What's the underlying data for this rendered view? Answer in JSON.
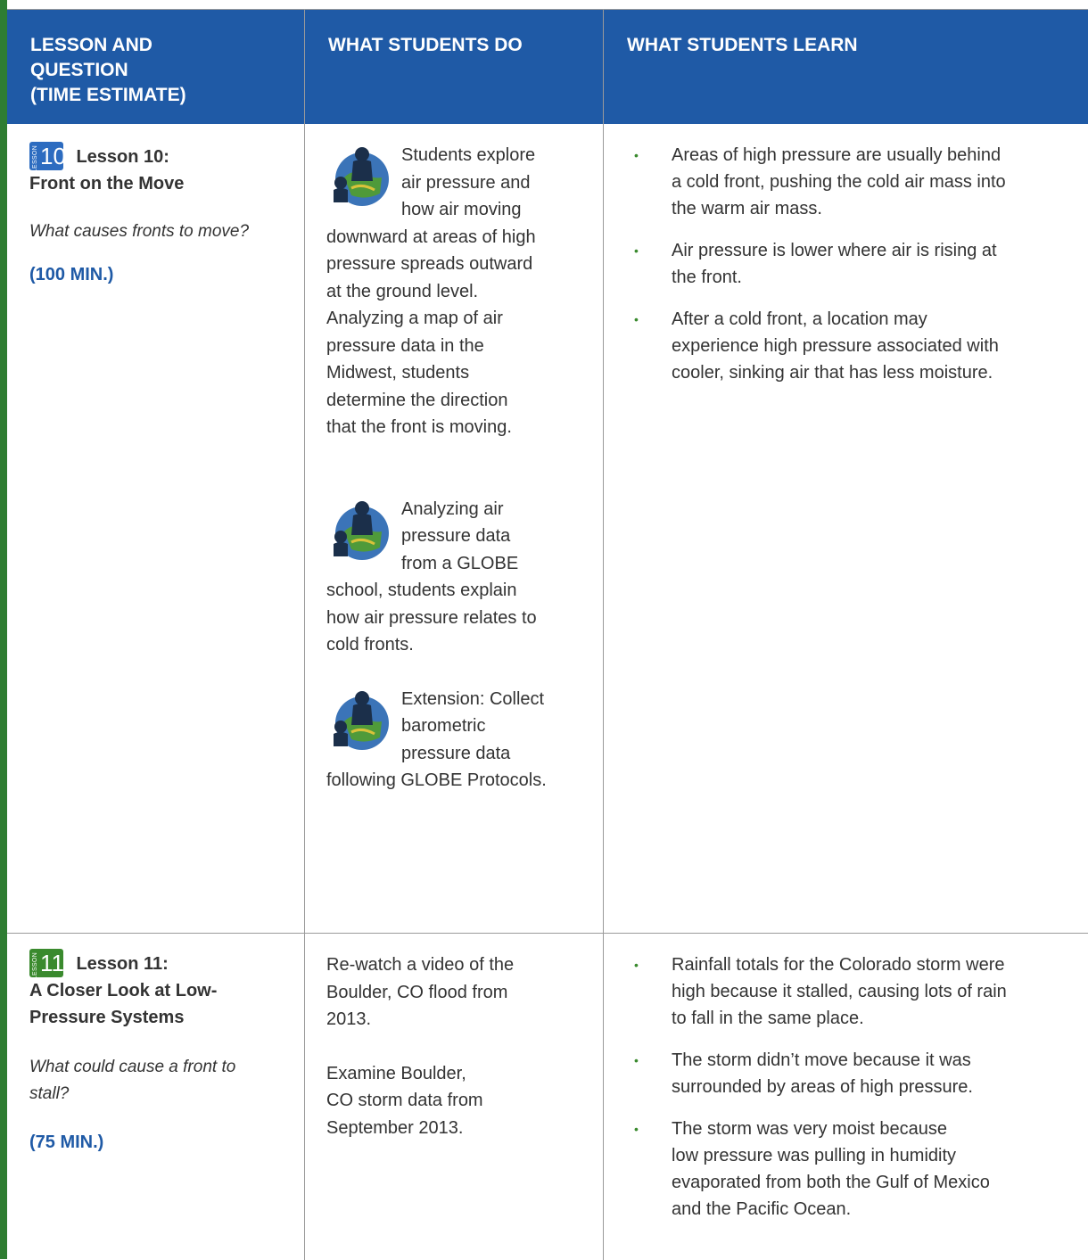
{
  "header": {
    "col1": [
      "LESSON AND",
      "QUESTION",
      "(TIME ESTIMATE)"
    ],
    "col2": "WHAT STUDENTS DO",
    "col3": "WHAT STUDENTS LEARN"
  },
  "rows": [
    {
      "badge_small": "LESSON",
      "badge_number": "10",
      "badge_color": "#2d6cc0",
      "title_line1": "Lesson 10:",
      "title_line2": "Front on the Move",
      "question": "What causes fronts to move?",
      "time": "(100 MIN.)",
      "activities": [
        {
          "icon": "globe-students-icon",
          "lines": [
            "Students explore",
            "air pressure and",
            "how air moving",
            "downward at areas of high",
            "pressure spreads outward",
            "at the ground level.",
            "Analyzing a map of air",
            "pressure data in the",
            "Midwest, students",
            "determine the direction",
            "that the front is moving."
          ]
        },
        {
          "icon": "globe-students-icon",
          "lines": [
            "Analyzing air",
            "pressure data",
            "from a GLOBE",
            "school, students explain",
            "how air pressure relates to",
            "cold fronts."
          ]
        },
        {
          "icon": "globe-students-icon",
          "lines": [
            "Extension: Collect",
            "barometric",
            "pressure data",
            "following GLOBE Protocols."
          ]
        }
      ],
      "learn": [
        [
          "Areas of high pressure are usually behind",
          "a cold front, pushing the cold air mass into",
          "the warm air mass."
        ],
        [
          "Air pressure is lower where air is rising at",
          "the front."
        ],
        [
          "After a cold front, a location may",
          "experience high pressure associated with",
          "cooler, sinking air that has less moisture."
        ]
      ]
    },
    {
      "badge_small": "LESSON",
      "badge_number": "11",
      "badge_color": "#3a8a2e",
      "title_line1": "Lesson 11:",
      "title_line2": "A Closer Look at Low-",
      "title_line3": "Pressure Systems",
      "question_lines": [
        "What could cause a front to",
        "stall?"
      ],
      "time": "(75 MIN.)",
      "do_paragraphs": [
        [
          "Re-watch a video of the",
          "Boulder, CO flood from",
          "2013."
        ],
        [
          "Examine Boulder,",
          "CO storm data from",
          "September 2013."
        ]
      ],
      "learn": [
        [
          "Rainfall totals for the Colorado storm were",
          "high because it stalled, causing lots of rain",
          "to fall in the same place."
        ],
        [
          "The storm didn’t move because it was",
          "surrounded by areas of high pressure."
        ],
        [
          "The storm was very moist because",
          "low pressure was pulling in humidity",
          "evaporated from both the Gulf of Mexico",
          "and the Pacific Ocean."
        ]
      ]
    }
  ],
  "colors": {
    "header_bg": "#1f5aa6",
    "accent_green": "#3a8a2e",
    "time_blue": "#1f5aa6"
  }
}
